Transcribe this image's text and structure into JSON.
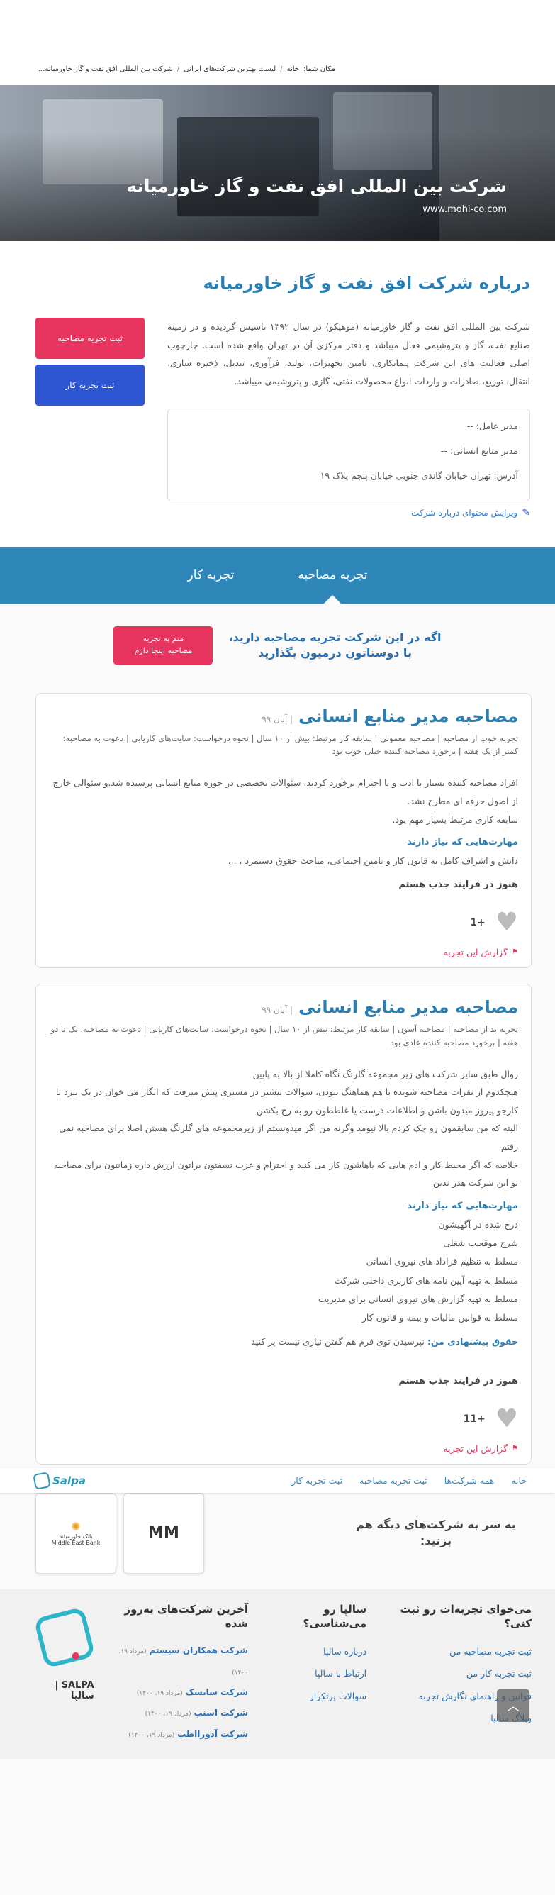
{
  "breadcrumb": {
    "prefix": "مکان شما:",
    "items": [
      "خانه",
      "لیست بهترین شرکت‌های ایرانی",
      "شرکت بین المللی افق نفت و گاز خاورمیانه..."
    ]
  },
  "hero": {
    "title": "شرکت بین المللی افق نفت و گاز خاورمیانه",
    "website": "www.mohi-co.com"
  },
  "about": {
    "heading": "درباره شرکت افق نفت و گاز خاورمیانه",
    "text": "شرکت بین المللی افق نفت و گاز خاورمیانه (موهیکو) در سال ۱۳۹۲ تاسیس گردیده و در زمینه صنایع نفت، گاز و پتروشیمی فعال میباشد و دفتر مرکزی آن در تهران واقع شده است. چارچوب اصلی فعالیت های این شرکت پیمانکاری، تامین تجهیزات، تولید، فرآوری، تبدیل، ذخیره سازی، انتقال، توزیع، صادرات و واردات انواع محصولات نفتی، گازی و پتروشیمی میباشد.",
    "buttons": {
      "interview": "ثبت تجربه مصاحبه",
      "work": "ثبت تجربه کار"
    },
    "info": {
      "ceo": "مدیر عامل: --",
      "hr": "مدیر منابع انسانی: --",
      "address": "آدرس: تهران خیابان گاندی جنوبی خیابان پنجم پلاک ۱۹"
    },
    "edit_link": "ویرایش محتوای درباره شرکت"
  },
  "tabs": {
    "interview": "تجربه مصاحبه",
    "work": "تجربه کار"
  },
  "cta": {
    "text_line1": "اگه در این شرکت تجربه مصاحبه دارید،",
    "text_line2": "با دوستاتون درمیون بگذارید",
    "button_line1": "منم یه تجربه",
    "button_line2": "مصاحبه اینجا دارم"
  },
  "reviews": [
    {
      "title": "مصاحبه مدیر منابع انسانی",
      "date": "| آبان ۹۹",
      "meta": "تجربه خوب از مصاحبه | مصاحبه معمولی | سابقه کار مرتبط: بیش از ۱۰ سال | نحوه درخواست: سایت‌های کاریابی | دعوت به مصاحبه: کمتر از یک هفته | برخورد مصاحبه کننده خیلی خوب بود",
      "body": [
        "افراد مصاحبه کننده بسیار با ادب و با احترام برخورد کردند. سئوالات تخصصی در حوزه منابع انسانی پرسیده شد.و سئوالی خارج از اصول حرفه ای مطرح نشد.",
        "سابقه کاری مرتبط بسیار مهم بود."
      ],
      "skills_heading": "مهارت‌هایی که نیاز دارند",
      "skills": [
        "دانش و اشراف کامل به قانون کار و تامین اجتماعی، مباحث حقوق دستمزد ، ..."
      ],
      "salary": "",
      "status": "هنوز در فرایند جذب هستم",
      "likes": "+1",
      "report": "گزارش این تجربه"
    },
    {
      "title": "مصاحبه مدیر منابع انسانی",
      "date": "| آبان ۹۹",
      "meta": "تجربه بد از مصاحبه | مصاحبه آسون | سابقه کار مرتبط: بیش از ۱۰ سال | نحوه درخواست: سایت‌های کاریابی | دعوت به مصاحبه: یک تا دو هفته | برخورد مصاحبه کننده عادی بود",
      "body": [
        "روال طبق سایر شرکت های زیر مجموعه گلرنگ نگاه کاملا از بالا به پایین",
        "هیچکدوم از نفرات مصاحبه شونده با هم هماهنگ نبودن، سوالات بیشتر در مسیری پیش میرفت که انگار می خوان در یک نبرد با کارجو پیروز میدون باشن و اطلاعات درست یا غلططون رو به رخ بکشن",
        "البته که من سابقمون رو چک کردم بالا نیومد وگرنه من اگر میدونستم از زیرمجموعه های گلرنگ هستن اصلا برای مصاحبه نمی رفتم",
        "خلاصه که اگر محیط کار و ادم هایی که باهاشون کار می کنید و احترام و عزت نسفتون براتون ارزش داره زمانتون برای مصاحبه تو این شرکت هدر ندین"
      ],
      "skills_heading": "مهارت‌هایی که نیاز دارند",
      "skills": [
        "درج شده در آگهیشون",
        "شرح موقعیت شغلی",
        "مسلط به تنظیم قراداد های نیروی انسانی",
        "مسلط به تهیه آیین نامه های کاربری داخلی شرکت",
        "مسلط به تهیه گزارش های نیروی انسانی برای مدیریت",
        "مسلط به قوانین مالیات و بیمه و قانون کار"
      ],
      "salary_label": "حقوق پیشنهادی من:",
      "salary": "نپرسیدن توی فرم هم گفتن نیازی نیست پر کنید",
      "status": "هنوز در فرایند جذب هستم",
      "likes": "+11",
      "report": "گزارش این تجربه"
    }
  ],
  "bottom_nav": {
    "items": [
      "خانه",
      "همه شرکت‌ها",
      "ثبت تجربه مصاحبه",
      "ثبت تجربه کار"
    ],
    "logo": "Salpa"
  },
  "others": {
    "heading": "یه سر به شرکت‌های دیگه هم بزنید:",
    "logos": [
      {
        "name": "بانک خاورمیانه",
        "sub": "Middle East Bank"
      },
      {
        "name": "MM",
        "sub": ""
      }
    ]
  },
  "footer": {
    "col1": {
      "heading": "می‌خوای تجربه‌ات رو ثبت کنی؟",
      "links": [
        "ثبت تجربه مصاحبه من",
        "ثبت تجربه کار من",
        "قوانین و راهنمای نگارش تجربه",
        "وبلاگ سالپا"
      ]
    },
    "col2": {
      "heading": "سالپا رو می‌شناسی؟",
      "links": [
        "درباره سالپا",
        "ارتباط با سالپا",
        "سوالات پرتکرار"
      ]
    },
    "col3": {
      "heading": "آخرین شرکت‌های به‌روز شده",
      "items": [
        {
          "name": "شرکت همکاران سیستم",
          "date": "(مرداد ۱۹، ۱۴۰۰)"
        },
        {
          "name": "شرکت سایسک",
          "date": "(مرداد ۱۹، ۱۴۰۰)"
        },
        {
          "name": "شرکت اسنپ",
          "date": "(مرداد ۱۹، ۱۴۰۰)"
        },
        {
          "name": "شرکت آدورااطب",
          "date": "(مرداد ۱۹، ۱۴۰۰)"
        }
      ]
    },
    "brand": "SALPA | سالپا"
  }
}
